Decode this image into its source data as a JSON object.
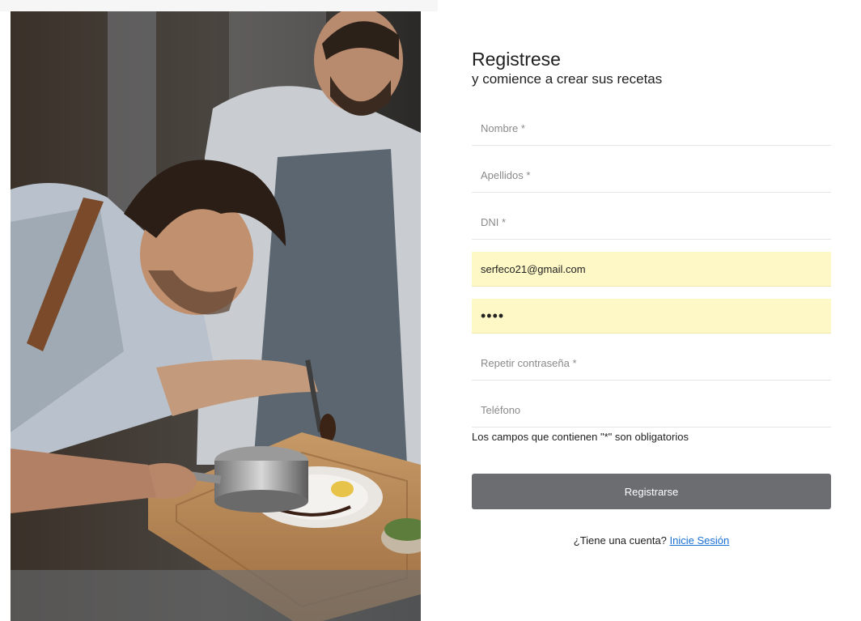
{
  "header": {
    "title": "Registrese",
    "subtitle": "y comience a crear sus recetas"
  },
  "form": {
    "nombre": {
      "placeholder": "Nombre *",
      "value": ""
    },
    "apellidos": {
      "placeholder": "Apellidos *",
      "value": ""
    },
    "dni": {
      "placeholder": "DNI *",
      "value": ""
    },
    "email": {
      "placeholder": "",
      "value": "serfeco21@gmail.com"
    },
    "password": {
      "placeholder": "",
      "value": "••••"
    },
    "repetir": {
      "placeholder": "Repetir contraseña *",
      "value": ""
    },
    "telefono": {
      "placeholder": "Teléfono",
      "value": ""
    },
    "required_note": "Los campos que contienen \"*\" son obligatorios",
    "submit_label": "Registrarse"
  },
  "footer": {
    "prompt": "¿Tiene una cuenta?",
    "login_link": "Inicie Sesión"
  },
  "colors": {
    "button": "#6c6d70",
    "autofill": "#fdf8c6",
    "link": "#1a6fd3"
  }
}
